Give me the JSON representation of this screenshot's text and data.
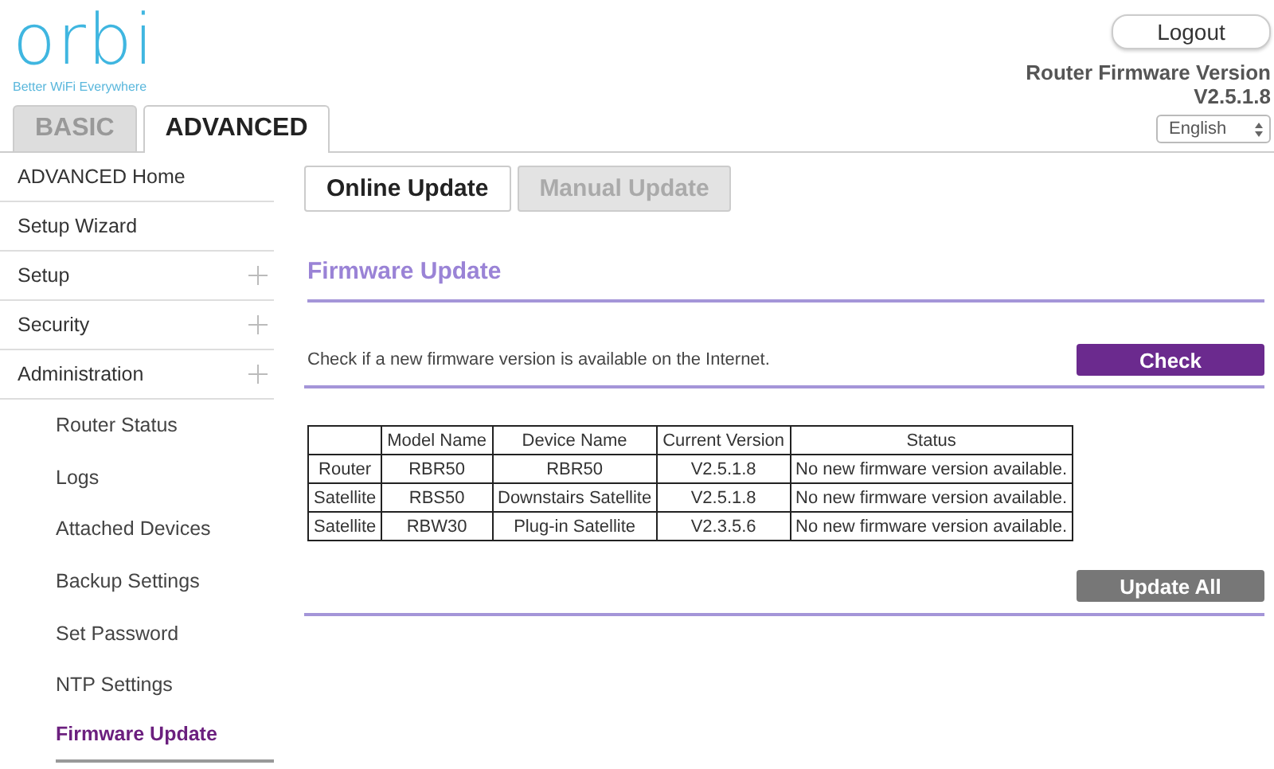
{
  "logo": {
    "wordmark": "orbi",
    "tagline": "Better WiFi Everywhere"
  },
  "mode_tabs": [
    {
      "label": "BASIC",
      "selected": false
    },
    {
      "label": "ADVANCED",
      "selected": true
    }
  ],
  "logout_button": {
    "label": "Logout"
  },
  "firmware": {
    "label": "Router Firmware Version",
    "version": "V2.5.1.8"
  },
  "language_select": {
    "value": "English"
  },
  "sidebar": {
    "items": [
      {
        "label": "ADVANCED Home",
        "expandable": false
      },
      {
        "label": "Setup Wizard",
        "expandable": false
      },
      {
        "label": "Setup",
        "expandable": true
      },
      {
        "label": "Security",
        "expandable": true
      },
      {
        "label": "Administration",
        "expandable": true,
        "children": [
          {
            "label": "Router Status",
            "selected": false
          },
          {
            "label": "Logs",
            "selected": false
          },
          {
            "label": "Attached Devices",
            "selected": false
          },
          {
            "label": "Backup Settings",
            "selected": false
          },
          {
            "label": "Set Password",
            "selected": false
          },
          {
            "label": "NTP Settings",
            "selected": false
          },
          {
            "label": "Firmware Update",
            "selected": true
          }
        ]
      }
    ]
  },
  "page_tabs": [
    {
      "label": "Online Update",
      "selected": true
    },
    {
      "label": "Manual Update",
      "selected": false
    }
  ],
  "section_title": "Firmware Update",
  "check_text": "Check if a new firmware version is available on the Internet.",
  "check_button": {
    "label": "Check",
    "disabled": false
  },
  "table": {
    "columns": [
      "",
      "Model Name",
      "Device Name",
      "Current Version",
      "Status"
    ],
    "rows": [
      [
        "Router",
        "RBR50",
        "RBR50",
        "V2.5.1.8",
        "No new firmware version available."
      ],
      [
        "Satellite",
        "RBS50",
        "Downstairs Satellite",
        "V2.5.1.8",
        "No new firmware version available."
      ],
      [
        "Satellite",
        "RBW30",
        "Plug-in Satellite",
        "V2.3.5.6",
        "No new firmware version available."
      ]
    ]
  },
  "update_all_button": {
    "label": "Update All",
    "disabled": true
  }
}
